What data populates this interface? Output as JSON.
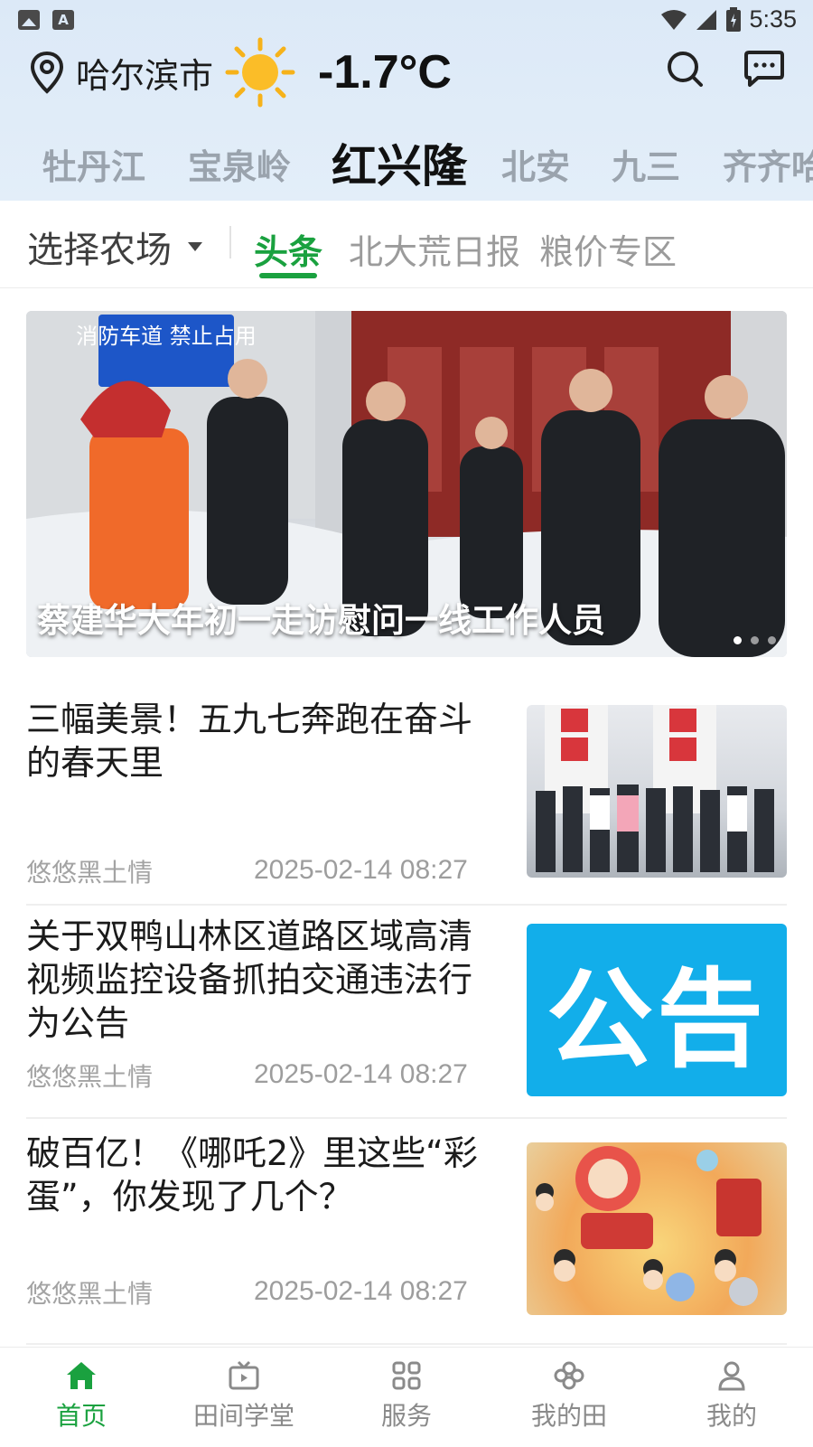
{
  "status_bar": {
    "time": "5:35"
  },
  "header": {
    "city": "哈尔滨市",
    "weather_icon": "sun-icon",
    "temperature": "-1.7°C"
  },
  "region_tabs": [
    {
      "label": "牡丹江",
      "active": false
    },
    {
      "label": "宝泉岭",
      "active": false
    },
    {
      "label": "红兴隆",
      "active": true
    },
    {
      "label": "北安",
      "active": false
    },
    {
      "label": "九三",
      "active": false
    },
    {
      "label": "齐齐哈尔",
      "active": false
    }
  ],
  "sub_nav": {
    "farm_select": "选择农场",
    "tabs": [
      {
        "label": "头条",
        "active": true
      },
      {
        "label": "北大荒日报",
        "active": false
      },
      {
        "label": "粮价专区",
        "active": false
      }
    ]
  },
  "banner": {
    "caption": "蔡建华大年初一走访慰问一线工作人员",
    "sign_text": "消防车道 禁止占用",
    "page_count": 3,
    "current_page": 1
  },
  "news": [
    {
      "title": "三幅美景！五九七奔跑在奋斗的春天里",
      "source": "悠悠黑土情",
      "date": "2025-02-14 08:27",
      "thumb": "group-photo"
    },
    {
      "title": "关于双鸭山林区道路区域高清视频监控设备抓拍交通违法行为公告",
      "source": "悠悠黑土情",
      "date": "2025-02-14 08:27",
      "thumb": "notice",
      "thumb_text": "公告"
    },
    {
      "title": "破百亿！《哪吒2》里这些“彩蛋”，你发现了几个？",
      "source": "悠悠黑土情",
      "date": "2025-02-14 08:27",
      "thumb": "nezha-merch"
    }
  ],
  "bottom_nav": [
    {
      "label": "首页",
      "icon": "home-icon",
      "active": true
    },
    {
      "label": "田间学堂",
      "icon": "tv-icon",
      "active": false
    },
    {
      "label": "服务",
      "icon": "grid-icon",
      "active": false
    },
    {
      "label": "我的田",
      "icon": "field-icon",
      "active": false
    },
    {
      "label": "我的",
      "icon": "person-icon",
      "active": false
    }
  ],
  "colors": {
    "accent": "#1aa13f",
    "header_bg": "#dce9f7",
    "notice_blue": "#12aeea"
  }
}
